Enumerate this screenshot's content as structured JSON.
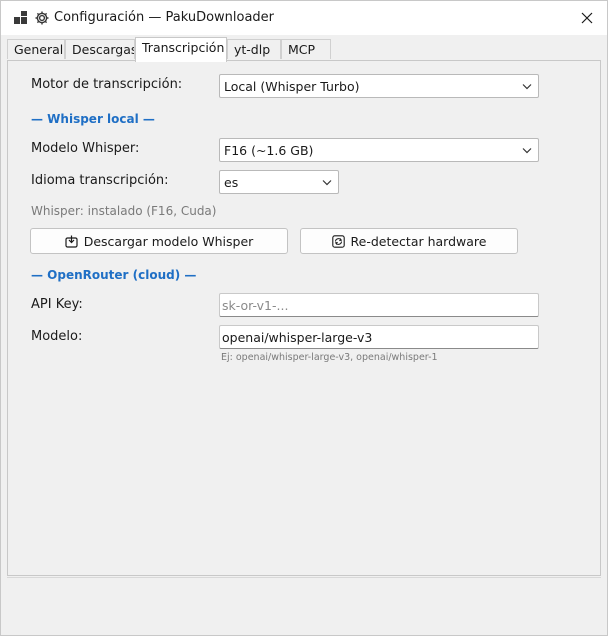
{
  "window": {
    "title": "Configuración — PakuDownloader"
  },
  "tabs": [
    {
      "label": "General"
    },
    {
      "label": "Descargas"
    },
    {
      "label": "Transcripción",
      "active": true
    },
    {
      "label": "yt-dlp"
    },
    {
      "label": "MCP"
    }
  ],
  "transcription": {
    "engine_label": "Motor de transcripción:",
    "engine_value": "Local (Whisper Turbo)",
    "local_section": "— Whisper local —",
    "model_label": "Modelo Whisper:",
    "model_value": "F16 (~1.6 GB)",
    "language_label": "Idioma transcripción:",
    "language_value": "es",
    "status_text": "Whisper: instalado (F16, Cuda)",
    "download_button": "Descargar modelo Whisper",
    "redetect_button": "Re-detectar hardware",
    "cloud_section": "— OpenRouter (cloud) —",
    "api_key_label": "API Key:",
    "api_key_placeholder": "sk-or-v1-...",
    "api_key_value": "",
    "cloud_model_label": "Modelo:",
    "cloud_model_value": "openai/whisper-large-v3",
    "cloud_model_hint": "Ej: openai/whisper-large-v3, openai/whisper-1"
  },
  "icons": {
    "app": "app-grid-icon",
    "settings": "gear-icon",
    "close": "close-icon",
    "dropdown": "chevron-down-icon",
    "download": "download-box-icon",
    "refresh": "refresh-icon"
  },
  "colors": {
    "section_heading": "#1f6fc5",
    "window_background": "#f0f0f0",
    "titlebar": "#ffffff"
  }
}
